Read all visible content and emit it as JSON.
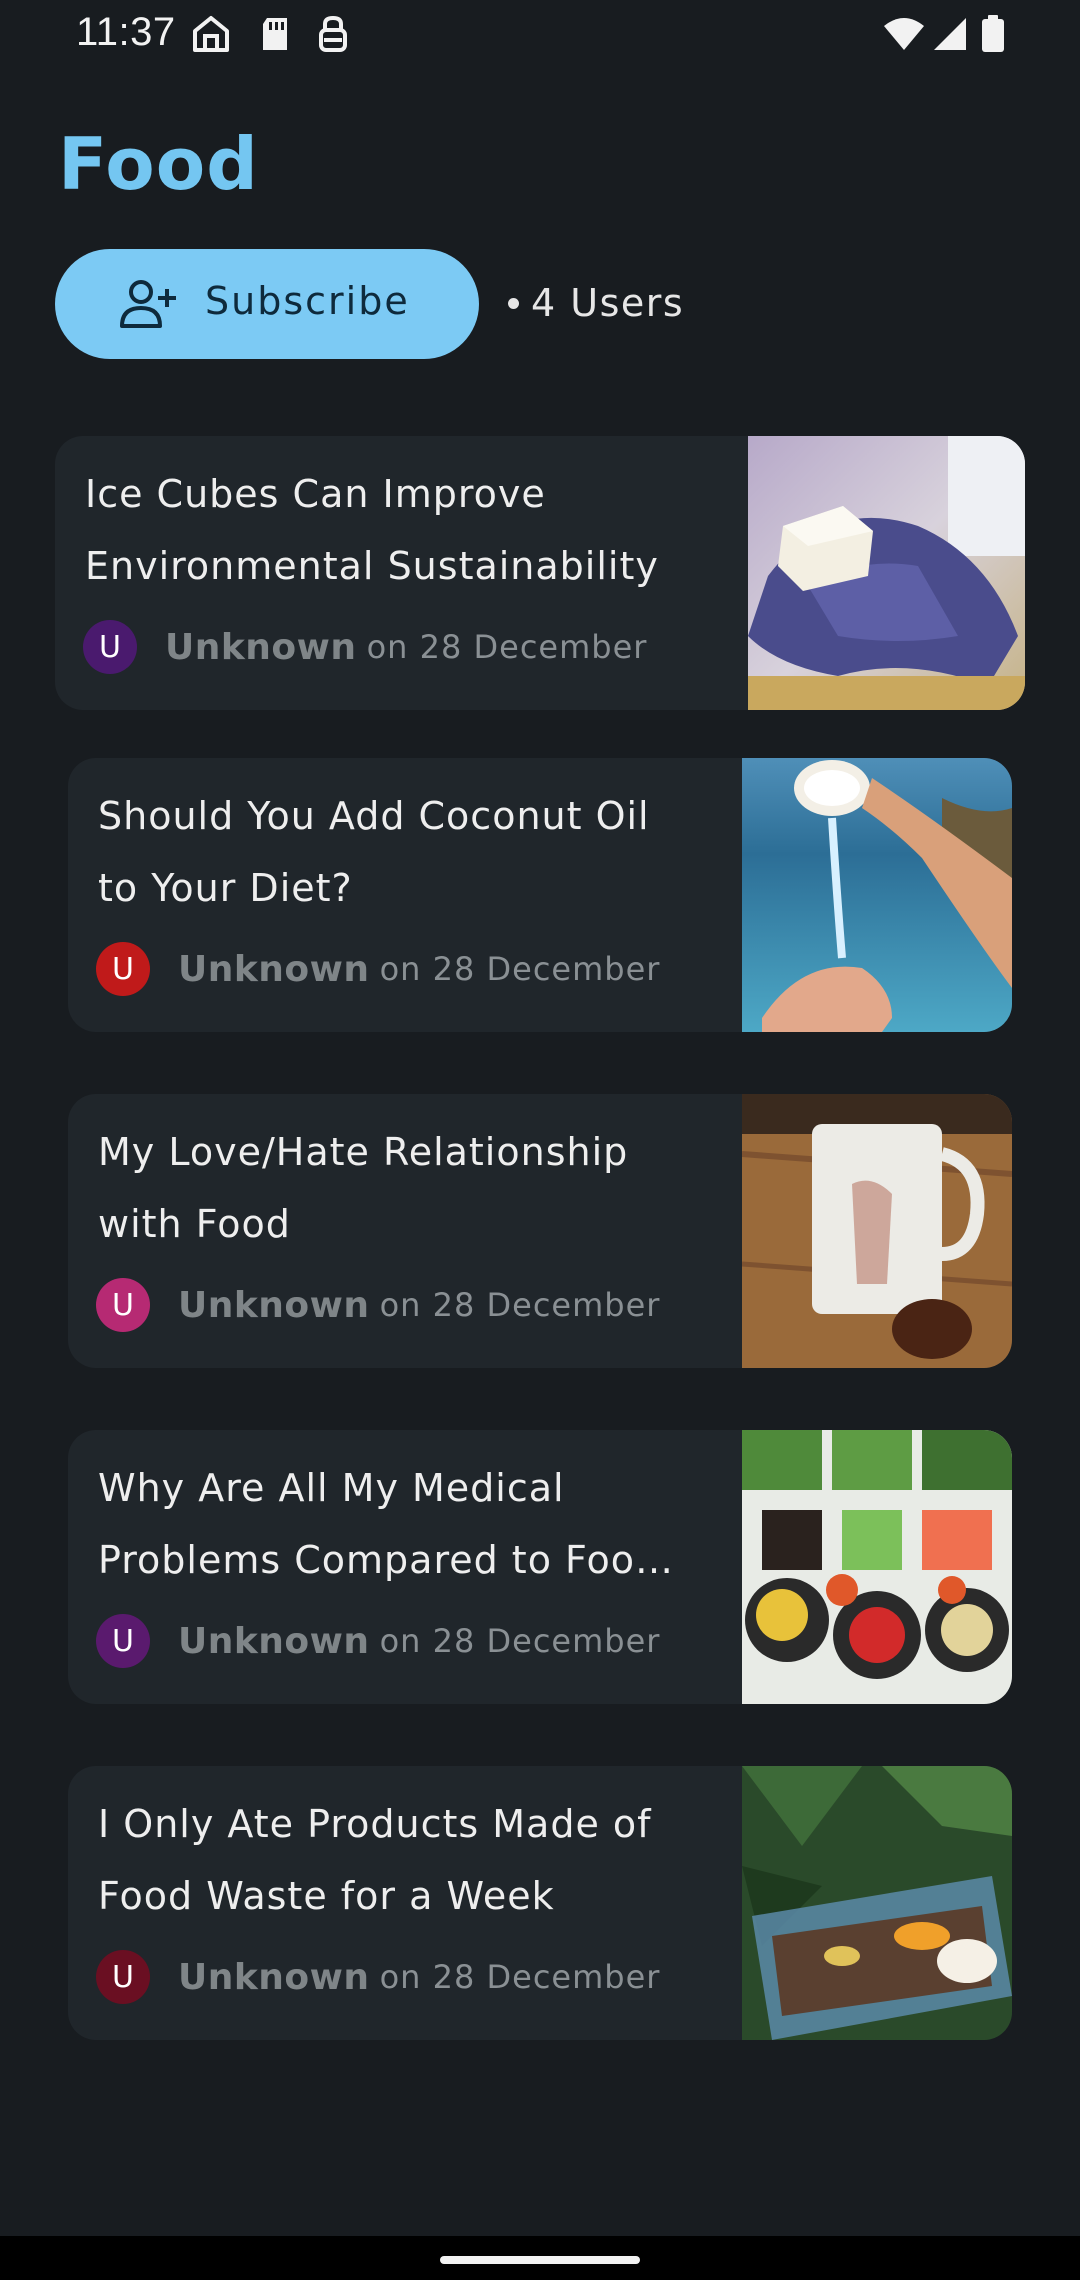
{
  "status_bar": {
    "time": "11:37",
    "icons_left": [
      "home-icon",
      "sd-card-icon",
      "vpn-key-icon"
    ],
    "icons_right": [
      "wifi-icon",
      "signal-icon",
      "battery-icon"
    ]
  },
  "header": {
    "title": "Food"
  },
  "subscribe": {
    "label": "Subscribe",
    "icon": "add-person-icon",
    "users": "4 Users"
  },
  "colors": {
    "accent": "#74c6f1",
    "button_bg": "#7ccaf4",
    "background": "#181c20",
    "card_bg": "#20262b"
  },
  "posts": [
    {
      "title_lines": [
        "Ice Cubes Can Improve",
        "Environmental Sustainability"
      ],
      "avatar_letter": "U",
      "avatar_color": "#4a1a6e",
      "author": "Unknown",
      "date": "on 28 December",
      "image": "gloved hand holding ice cube"
    },
    {
      "title_lines": [
        "Should You Add Coconut Oil",
        "to Your Diet?"
      ],
      "avatar_letter": "U",
      "avatar_color": "#c01a1a",
      "author": "Unknown",
      "date": "on 28 December",
      "image": "coconut water poured over sea"
    },
    {
      "title_lines": [
        "My Love/Hate Relationship",
        "with Food"
      ],
      "avatar_letter": "U",
      "avatar_color": "#b62a73",
      "author": "Unknown",
      "date": "on 28 December",
      "image": "mug and cookie on wooden table"
    },
    {
      "title_lines": [
        "Why Are All My Medical",
        "Problems Compared to Foo…"
      ],
      "avatar_letter": "U",
      "avatar_color": "#5a1a6e",
      "author": "Unknown",
      "date": "on 28 December",
      "image": "bowls of vegetables and legumes"
    },
    {
      "title_lines": [
        "I Only Ate Products Made of",
        "Food Waste for a Week"
      ],
      "avatar_letter": "U",
      "avatar_color": "#6a0f22",
      "author": "Unknown",
      "date": "on 28 December",
      "image": "container of pasta with orange peel"
    }
  ]
}
